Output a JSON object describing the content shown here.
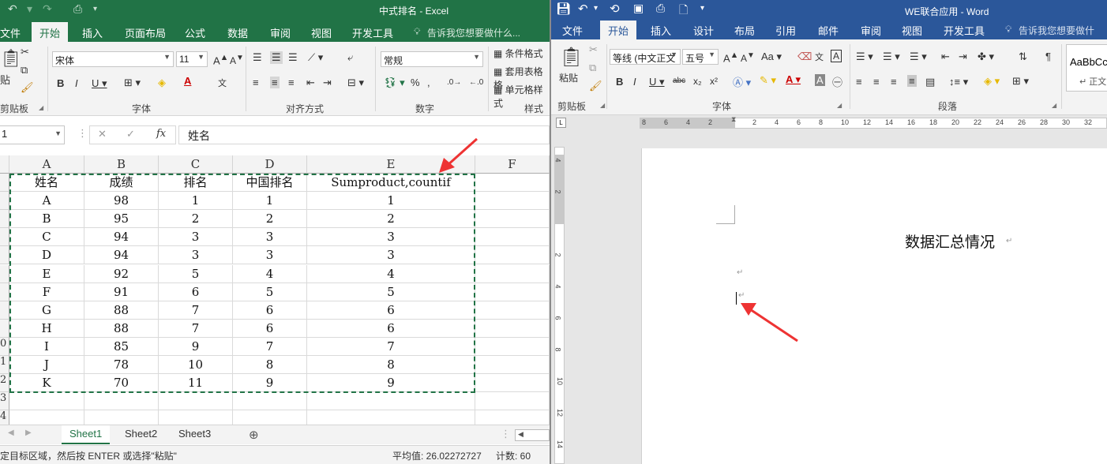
{
  "excel": {
    "title": "中式排名 - Excel",
    "tabs": [
      "文件",
      "开始",
      "插入",
      "页面布局",
      "公式",
      "数据",
      "审阅",
      "视图",
      "开发工具"
    ],
    "tell_me": "告诉我您想要做什么...",
    "font_name": "宋体",
    "font_size": "11",
    "number_format": "常规",
    "styles_items": [
      "条件格式",
      "套用表格格",
      "单元格样式"
    ],
    "group_labels": [
      "剪贴板",
      "字体",
      "对齐方式",
      "数字",
      "样式"
    ],
    "paste_label": "贴",
    "name_box": "1",
    "fx": "fx",
    "formula_text": "姓名",
    "column_headers": [
      "A",
      "B",
      "C",
      "D",
      "E",
      "F"
    ],
    "row_numbers": [
      "",
      "",
      "",
      "",
      "",
      "",
      "",
      "",
      "",
      "0",
      "1",
      "2",
      "3",
      "4"
    ],
    "table_headers": [
      "姓名",
      "成绩",
      "排名",
      "中国排名",
      "Sumproduct,countif"
    ],
    "rows": [
      [
        "A",
        "98",
        "1",
        "1",
        "1"
      ],
      [
        "B",
        "95",
        "2",
        "2",
        "2"
      ],
      [
        "C",
        "94",
        "3",
        "3",
        "3"
      ],
      [
        "D",
        "94",
        "3",
        "3",
        "3"
      ],
      [
        "E",
        "92",
        "5",
        "4",
        "4"
      ],
      [
        "F",
        "91",
        "6",
        "5",
        "5"
      ],
      [
        "G",
        "88",
        "7",
        "6",
        "6"
      ],
      [
        "H",
        "88",
        "7",
        "6",
        "6"
      ],
      [
        "I",
        "85",
        "9",
        "7",
        "7"
      ],
      [
        "J",
        "78",
        "10",
        "8",
        "8"
      ],
      [
        "K",
        "70",
        "11",
        "9",
        "9"
      ]
    ],
    "sheets": [
      "Sheet1",
      "Sheet2",
      "Sheet3"
    ],
    "status_message": "定目标区域，然后按 ENTER 或选择\"粘贴\"",
    "status_average": "平均值: 26.02272727",
    "status_count": "计数: 60"
  },
  "word": {
    "title": "WE联合应用 - Word",
    "tabs": [
      "文件",
      "开始",
      "插入",
      "设计",
      "布局",
      "引用",
      "邮件",
      "审阅",
      "视图",
      "开发工具"
    ],
    "tell_me": "告诉我您想要做什么...",
    "font_name": "等线 (中文正文",
    "font_size": "五号",
    "paste_label": "粘贴",
    "group_labels": [
      "剪贴板",
      "字体",
      "段落"
    ],
    "style_preview": "AaBbCc",
    "style_name": "↵ 正文",
    "ruler_ticks": [
      "8",
      "6",
      "4",
      "2",
      "",
      "2",
      "4",
      "6",
      "8",
      "10",
      "12",
      "14",
      "16",
      "18",
      "20",
      "22",
      "24",
      "26",
      "28",
      "30",
      "32"
    ],
    "vruler_ticks": [
      "4",
      "2",
      "",
      "2",
      "4",
      "6",
      "8",
      "10",
      "12",
      "14"
    ],
    "doc_heading": "数据汇总情况",
    "para_mark": "↵"
  },
  "colors": {
    "excel_green": "#217346",
    "word_blue": "#2b579a",
    "arrow_red": "#ee3333"
  }
}
